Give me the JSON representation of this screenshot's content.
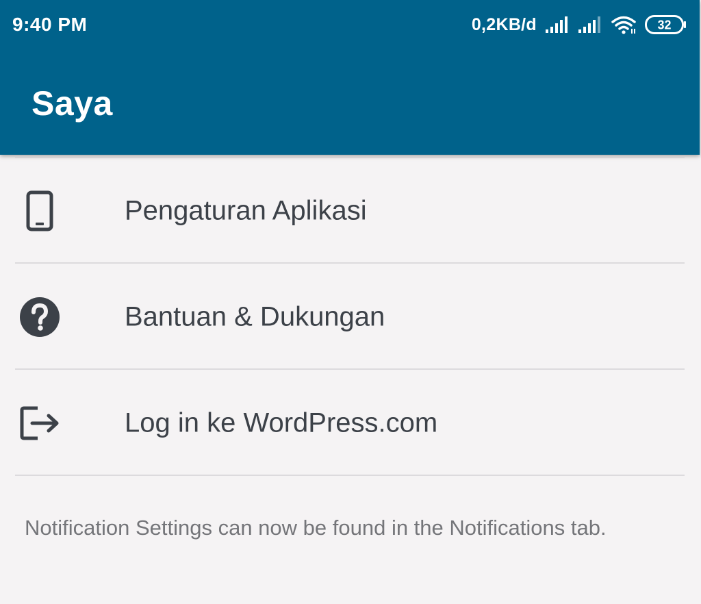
{
  "status_bar": {
    "time": "9:40 PM",
    "net_speed": "0,2KB/d",
    "battery_level": "32",
    "icons": [
      "signal-icon",
      "signal-icon",
      "wifi-icon",
      "battery-icon"
    ]
  },
  "header": {
    "title": "Saya",
    "background_color": "#00628b"
  },
  "menu": {
    "items": [
      {
        "label": "Pengaturan Aplikasi",
        "icon": "phone-icon"
      },
      {
        "label": "Bantuan & Dukungan",
        "icon": "help-icon"
      },
      {
        "label": "Log in ke WordPress.com",
        "icon": "login-icon"
      }
    ]
  },
  "notice": {
    "text": "Notification Settings can now be found in the Notifications tab."
  },
  "colors": {
    "background": "#f5f3f4",
    "icon": "#3c4148",
    "text_primary": "#3c4148",
    "text_secondary": "#747579"
  }
}
